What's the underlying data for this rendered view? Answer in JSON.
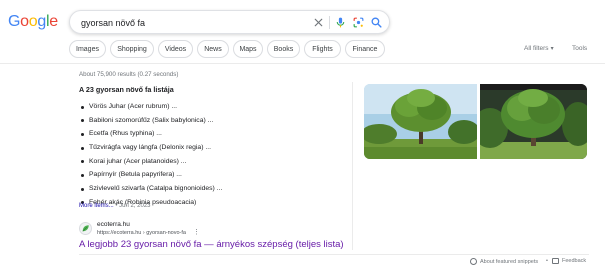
{
  "logo": {
    "letters": [
      "G",
      "o",
      "o",
      "g",
      "l",
      "e"
    ],
    "colors": [
      "#4285f4",
      "#ea4335",
      "#fbbc05",
      "#4285f4",
      "#34a853",
      "#ea4335"
    ]
  },
  "search": {
    "query": "gyorsan növő fa",
    "icons": [
      "close-icon",
      "microphone-icon",
      "lens-icon",
      "search-icon"
    ]
  },
  "chips": [
    "Images",
    "Shopping",
    "Videos",
    "News",
    "Maps",
    "Books",
    "Flights",
    "Finance"
  ],
  "tools": {
    "all_filters": "All filters",
    "tools": "Tools"
  },
  "results_stats": "About 75,900 results (0.27 seconds)",
  "featured_snippet": {
    "title": "A 23 gyorsan növő fa listája",
    "items": [
      "Vörös Juhar (Acer rubrum) ...",
      "Babiloni szomorúfűz (Salix babylonica) ...",
      "Ecetfa (Rhus typhina) ...",
      "Tűzvirágfa vagy lángfa (Delonix regia) ...",
      "Korai juhar (Acer platanoides) ...",
      "Papírnyír (Betula papyrifera) ...",
      "Szivlevelű szivarfa (Catalpa bignonioides) ...",
      "Fehér akác (Robinia pseudoacacia)"
    ],
    "more_items": "More items...",
    "date": "• Jun 2, 2023"
  },
  "source": {
    "site_name": "ecoterra.hu",
    "url": "https://ecoterra.hu › gyorsan-novo-fa",
    "link_title": "A legjobb 23 gyorsan növő fa — árnyékos szépség (teljes lista)"
  },
  "footer": {
    "about": "About featured snippets",
    "separator": "•",
    "feedback": "Feedback"
  },
  "colors": {
    "link_visited": "#681da8",
    "link": "#1a0dab",
    "muted": "#70757a",
    "border": "#dadce0"
  }
}
